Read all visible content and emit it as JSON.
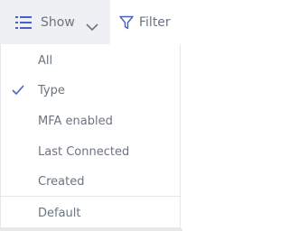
{
  "toolbar": {
    "show_label": "Show",
    "filter_label": "Filter",
    "show_icon": "list-icon",
    "show_chevron": "chevron-down-icon",
    "filter_icon": "funnel-icon"
  },
  "menu": {
    "items": [
      {
        "label": "All",
        "checked": false
      },
      {
        "label": "Type",
        "checked": true
      },
      {
        "label": "MFA enabled",
        "checked": false
      },
      {
        "label": "Last Connected",
        "checked": false
      },
      {
        "label": "Created",
        "checked": false
      }
    ],
    "footer": {
      "label": "Default"
    }
  },
  "colors": {
    "accent": "#4a5fc1",
    "text": "#6b7480",
    "button_bg": "#eef0f3",
    "border": "#e3e6ea"
  }
}
